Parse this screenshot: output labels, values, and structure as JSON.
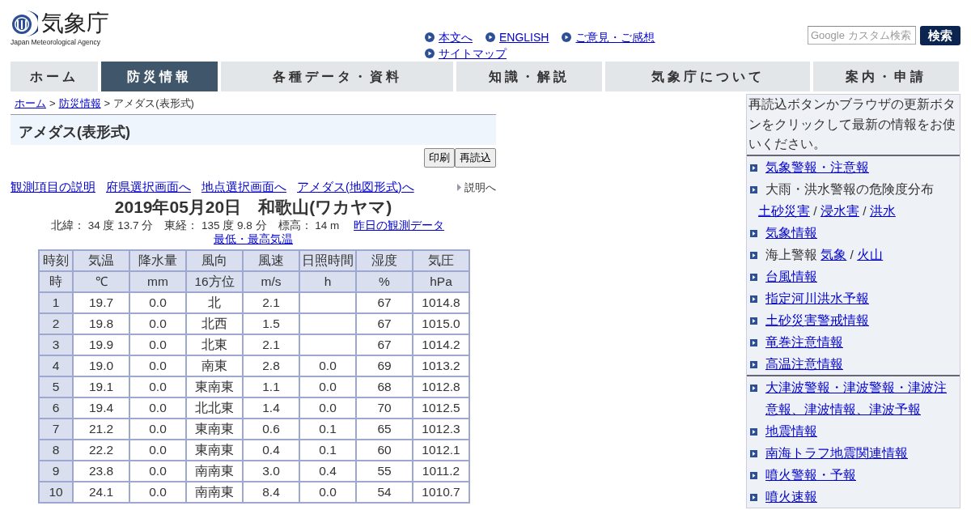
{
  "logo": {
    "name": "気象庁",
    "subtitle": "Japan Meteorological Agency"
  },
  "header_links": [
    {
      "label": "本文へ"
    },
    {
      "label": "ENGLISH"
    },
    {
      "label": "ご意見・ご感想"
    },
    {
      "label": "サイトマップ"
    }
  ],
  "search": {
    "placeholder": "Google カスタム検索",
    "button": "検索"
  },
  "nav_tabs": [
    {
      "label": "ホーム",
      "selected": false
    },
    {
      "label": "防災情報",
      "selected": true
    },
    {
      "label": "各種データ・資料",
      "selected": false
    },
    {
      "label": "知識・解説",
      "selected": false
    },
    {
      "label": "気象庁について",
      "selected": false
    },
    {
      "label": "案内・申請",
      "selected": false
    }
  ],
  "breadcrumb": [
    {
      "label": "ホーム",
      "kind": "link"
    },
    {
      "label": "防災情報",
      "kind": "link"
    },
    {
      "label": "アメダス(表形式)",
      "kind": "text"
    }
  ],
  "breadcrumb_separator": ">",
  "page_title": "アメダス(表形式)",
  "toolbar_buttons": [
    "印刷",
    "再読込"
  ],
  "sub_links": [
    "観測項目の説明",
    "府県選択画面へ",
    "地点選択画面へ",
    "アメダス(地図形式)へ"
  ],
  "help_link": "説明へ",
  "heading": "2019年05月20日　和歌山(ワカヤマ)",
  "station_info": "北緯：  34 度 13.7 分　東経：  135 度 9.8 分　標高：  14 m",
  "station_links": [
    "昨日の観測データ",
    "最低・最高気温"
  ],
  "table": {
    "columns": [
      "時刻",
      "気温",
      "降水量",
      "風向",
      "風速",
      "日照時間",
      "湿度",
      "気圧"
    ],
    "units": [
      "時",
      "℃",
      "mm",
      "16方位",
      "m/s",
      "h",
      "%",
      "hPa"
    ],
    "rows": [
      [
        "1",
        "19.7",
        "0.0",
        "北",
        "2.1",
        "",
        "67",
        "1014.8"
      ],
      [
        "2",
        "19.8",
        "0.0",
        "北西",
        "1.5",
        "",
        "67",
        "1015.0"
      ],
      [
        "3",
        "19.9",
        "0.0",
        "北東",
        "2.1",
        "",
        "67",
        "1014.2"
      ],
      [
        "4",
        "19.0",
        "0.0",
        "南東",
        "2.8",
        "0.0",
        "69",
        "1013.2"
      ],
      [
        "5",
        "19.1",
        "0.0",
        "東南東",
        "1.1",
        "0.0",
        "68",
        "1012.8"
      ],
      [
        "6",
        "19.4",
        "0.0",
        "北北東",
        "1.4",
        "0.0",
        "70",
        "1012.5"
      ],
      [
        "7",
        "21.2",
        "0.0",
        "東南東",
        "0.6",
        "0.1",
        "65",
        "1012.3"
      ],
      [
        "8",
        "22.2",
        "0.0",
        "東南東",
        "0.4",
        "0.1",
        "60",
        "1012.1"
      ],
      [
        "9",
        "23.8",
        "0.0",
        "南南東",
        "3.0",
        "0.4",
        "55",
        "1011.2"
      ],
      [
        "10",
        "24.1",
        "0.0",
        "南南東",
        "8.4",
        "0.0",
        "54",
        "1010.7"
      ]
    ]
  },
  "sidebar": {
    "notice": "再読込ボタンかブラウザの更新ボタンをクリックして最新の情報をお使いください。",
    "groups": [
      [
        {
          "parts": [
            {
              "kind": "link",
              "text": "気象警報・注意報"
            }
          ]
        },
        {
          "parts": [
            {
              "kind": "text",
              "text": "大雨・洪水警報の危険度分布"
            },
            {
              "kind": "break"
            },
            {
              "kind": "link",
              "text": "土砂災害"
            },
            {
              "kind": "text",
              "text": " / "
            },
            {
              "kind": "link",
              "text": "浸水害"
            },
            {
              "kind": "text",
              "text": " / "
            },
            {
              "kind": "link",
              "text": "洪水"
            }
          ]
        },
        {
          "parts": [
            {
              "kind": "link",
              "text": "気象情報"
            }
          ]
        },
        {
          "parts": [
            {
              "kind": "text",
              "text": "海上警報 "
            },
            {
              "kind": "link",
              "text": "気象"
            },
            {
              "kind": "text",
              "text": " / "
            },
            {
              "kind": "link",
              "text": "火山"
            }
          ]
        },
        {
          "parts": [
            {
              "kind": "link",
              "text": "台風情報"
            }
          ]
        },
        {
          "parts": [
            {
              "kind": "link",
              "text": "指定河川洪水予報"
            }
          ]
        },
        {
          "parts": [
            {
              "kind": "link",
              "text": "土砂災害警戒情報"
            }
          ]
        },
        {
          "parts": [
            {
              "kind": "link",
              "text": "竜巻注意情報"
            }
          ]
        },
        {
          "parts": [
            {
              "kind": "link",
              "text": "高温注意情報"
            }
          ]
        }
      ],
      [
        {
          "parts": [
            {
              "kind": "link",
              "text": "大津波警報・津波警報・津波注意報、津波情報、津波予報"
            }
          ]
        },
        {
          "parts": [
            {
              "kind": "link",
              "text": "地震情報"
            }
          ]
        },
        {
          "parts": [
            {
              "kind": "link",
              "text": "南海トラフ地震関連情報"
            }
          ]
        },
        {
          "parts": [
            {
              "kind": "link",
              "text": "噴火警報・予報"
            }
          ]
        },
        {
          "parts": [
            {
              "kind": "link",
              "text": "噴火速報"
            }
          ]
        }
      ]
    ]
  }
}
